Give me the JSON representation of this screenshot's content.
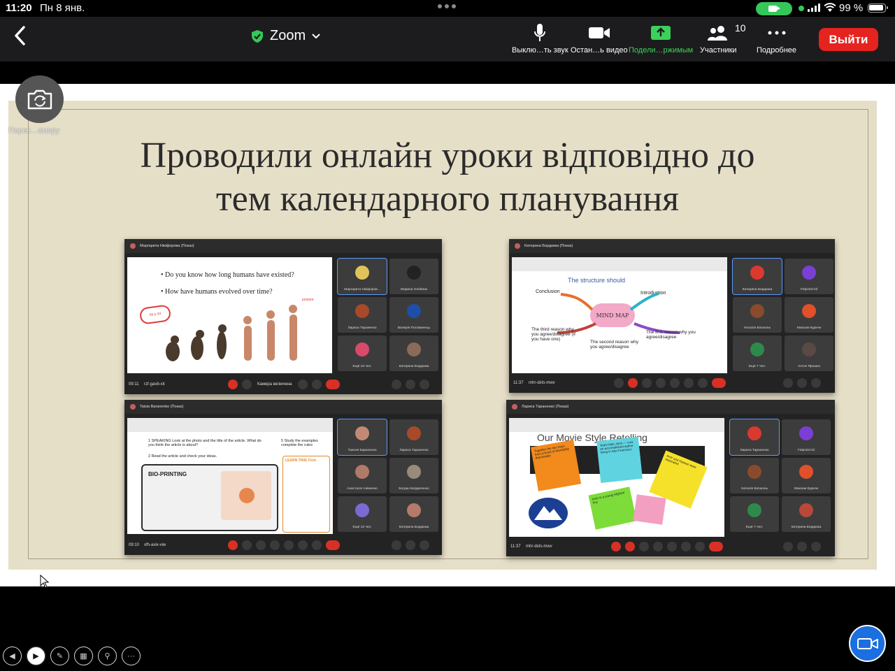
{
  "status_bar": {
    "time": "11:20",
    "date": "Пн 8 янв.",
    "battery": "99 %",
    "battery_level": 0.99
  },
  "toolbar": {
    "app_title": "Zoom",
    "buttons": {
      "mute": "Выклю…ть звук",
      "video": "Остан…ь видео",
      "share": "Подели…ржимым",
      "participants": "Участники",
      "participants_count": "10",
      "more": "Подробнее"
    },
    "leave": "Выйти",
    "colors": {
      "accent_green": "#3bd15a",
      "leave_red": "#e5231f",
      "video_blue": "#1b6fe0"
    }
  },
  "overlay": {
    "switch_camera_label": "Перек…амеру"
  },
  "slide": {
    "title_line1": "Проводили онлайн уроки відповідно до",
    "title_line2": "тем календарного планування"
  },
  "screenshots": {
    "tl": {
      "presenter": "Маргарита Нікіфорова (Показ)",
      "meeting_id": "rzf-gavb-xit",
      "time": "09:11",
      "q1": "• Do you know how long humans have existed?",
      "q2": "• How have humans evolved over time?",
      "stamp": "59 p.34",
      "posture": "posture",
      "camera_on": "Камера включена",
      "tiles": [
        "Маргарита Нікіфоров...",
        "Марина Олейник",
        "Лариса Тараненко",
        "Валерія Половинець",
        "Ещё 10 чел.",
        "Катерина Бордюжа"
      ]
    },
    "tr": {
      "presenter": "Катерина Бордюжа (Показ)",
      "meeting_id": "mhr-dxts-mwv",
      "time": "11:37",
      "heading": "The structure should",
      "conclusion": "Conclusion",
      "introduction": "Introduction",
      "mind_map": "MIND MAP",
      "third_reason": "The third reason why you agree/disagree (if you have one)",
      "second_reason": "The second reason why you agree/disagree",
      "first_reason": "The first reason why you agree/disagree",
      "tiles": [
        "Катерина Бордюжа",
        "Felpmist lol",
        "Наталія Білоконь",
        "Максим Куричи",
        "Ещё 7 чел.",
        "Антон Ярошко"
      ]
    },
    "bl": {
      "presenter": "Taisia Baranenko (Показ)",
      "meeting_id": "xfh-avix-viw",
      "time": "09:10",
      "speaking": "1 SPEAKING Look at the photo and the title of the article. What do you think the article is about?",
      "read": "2 Read the article and check your ideas.",
      "study": "5 Study the examples complete the rules",
      "learn": "LEARN THIS! First",
      "bio": "BIO-PRINTING",
      "tiles": [
        "Таисия Бараненко",
        "Лариса Тараненко",
        "Анастасія Аніменко",
        "Богдан Бердиченко",
        "Ещё 10 чел.",
        "Катерина Бордюжа"
      ]
    },
    "br": {
      "presenter": "Лариса Тараненко (Показ)",
      "meeting_id": "mhr-dxts-mwv",
      "time": "11:37",
      "slide_title": "Our Movie Style Retelling",
      "note1": "Together the two boys form a bond of friendship that breaks",
      "note2": "Years later, Amir — now an accomplished author living in San Francisco",
      "note3": "Amir and Hassan were separated",
      "note4": "Amir is a young Afghani boy",
      "tiles": [
        "Лариса Тараненко",
        "Felpmist lol",
        "Наталія Білоконь",
        "Максим Куричи",
        "Ещё 7 чел.",
        "Катерина Бордюжа"
      ]
    }
  }
}
